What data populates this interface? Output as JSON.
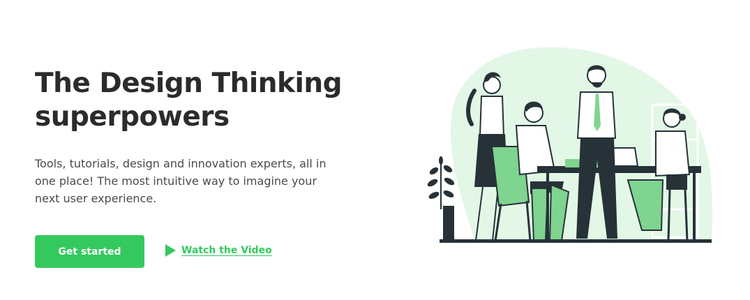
{
  "hero": {
    "title_line1": "The Design Thinking",
    "title_line2": "superpowers",
    "subtitle": "Tools, tutorials, design and innovation experts, all in one place! The most intuitive way to imagine your next user experience.",
    "cta_label": "Get started",
    "video_label": "Watch the Video"
  },
  "icons": {
    "play": "play-icon"
  },
  "colors": {
    "accent": "#34c95f",
    "heading": "#2b2b2b",
    "body_text": "#4a4a4a",
    "illustration_bg": "#e2f7e6",
    "illustration_green": "#7fd48f",
    "illustration_dark": "#263238"
  }
}
